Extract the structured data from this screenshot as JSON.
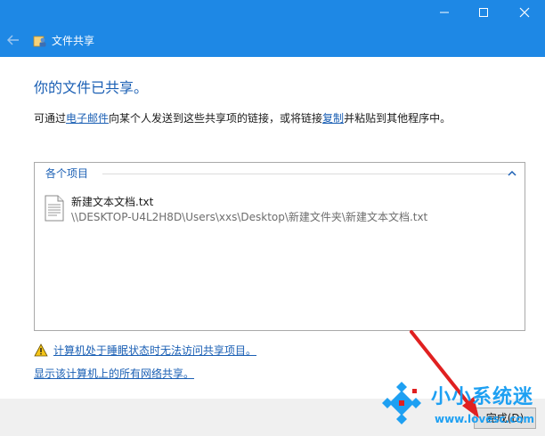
{
  "window": {
    "title": "文件共享",
    "minimize_icon": "minimize-icon",
    "maximize_icon": "maximize-icon",
    "close_icon": "close-icon",
    "back_icon": "back-arrow-icon",
    "app_icon": "file-sharing-icon",
    "accent_color": "#1e88e5"
  },
  "main": {
    "heading": "你的文件已共享。",
    "desc_prefix": "可通过",
    "email_link": "电子邮件",
    "desc_middle": "向某个人发送到这些共享项的链接，或将链接",
    "copy_link": "复制",
    "desc_suffix": "并粘贴到其他程序中。"
  },
  "items": {
    "group_label": "各个项目",
    "chevron_icon": "chevron-up-icon",
    "file": {
      "icon": "text-document-icon",
      "name": "新建文本文档.txt",
      "path": "\\\\DESKTOP-U4L2H8D\\Users\\xxs\\Desktop\\新建文件夹\\新建文本文档.txt"
    }
  },
  "links": {
    "warning_icon": "warning-icon",
    "sleep_warning": "计算机处于睡眠状态时无法访问共享项目。",
    "show_shares": "显示该计算机上的所有网络共享。"
  },
  "footer": {
    "done_label": "完成(D)"
  },
  "watermark": {
    "text": "小小系统迷",
    "url": "www.lovesc.com",
    "color": "#1ea0f2"
  },
  "annotation": {
    "arrow_color": "#e02020"
  }
}
